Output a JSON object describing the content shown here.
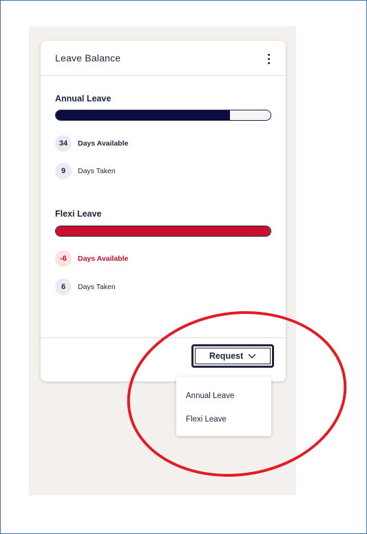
{
  "card": {
    "title": "Leave Balance",
    "menu_icon": "kebab-menu-icon"
  },
  "leave_types": [
    {
      "name": "Annual Leave",
      "progress_fraction": 0.81,
      "bar_color": "#0b0d3d",
      "days_available": "34",
      "days_available_label": "Days Available",
      "days_taken": "9",
      "days_taken_label": "Days Taken"
    },
    {
      "name": "Flexi Leave",
      "progress_fraction": 1.0,
      "bar_color": "#c8102e",
      "days_available": "-6",
      "days_available_label": "Days Available",
      "days_taken": "6",
      "days_taken_label": "Days Taken"
    }
  ],
  "request": {
    "label": "Request",
    "icon": "chevron-down-icon",
    "options": [
      "Annual Leave",
      "Flexi Leave"
    ]
  },
  "colors": {
    "navy": "#1f2340",
    "red": "#c8102e",
    "annotation_circle": "#e31b23",
    "panel_background": "#f3f0ed"
  }
}
